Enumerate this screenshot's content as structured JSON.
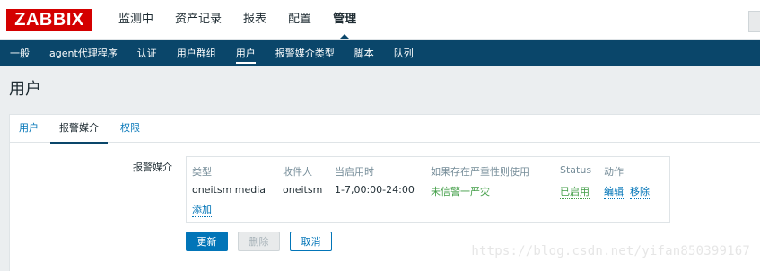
{
  "header": {
    "logo": "ZABBIX",
    "menu": [
      "监测中",
      "资产记录",
      "报表",
      "配置",
      "管理"
    ],
    "active_menu": "管理"
  },
  "submenu": {
    "items": [
      "一般",
      "agent代理程序",
      "认证",
      "用户群组",
      "用户",
      "报警媒介类型",
      "脚本",
      "队列"
    ],
    "active": "用户"
  },
  "page": {
    "title": "用户"
  },
  "tabs": {
    "items": [
      "用户",
      "报警媒介",
      "权限"
    ],
    "active": "报警媒介"
  },
  "form": {
    "media_label": "报警媒介",
    "columns": [
      "类型",
      "收件人",
      "当启用时",
      "如果存在严重性则使用",
      "Status",
      "动作"
    ],
    "row": {
      "type": "oneitsm media",
      "recipient": "oneitsm",
      "when_active": "1-7,00:00-24:00",
      "severity": "未信警一严灾",
      "status": "已启用",
      "action_edit": "编辑",
      "action_remove": "移除"
    },
    "add_link": "添加",
    "buttons": {
      "update": "更新",
      "delete": "删除",
      "cancel": "取消"
    }
  },
  "watermark": "https://blog.csdn.net/yifan850399167",
  "colors": {
    "brand_red": "#d40000",
    "nav_blue": "#0a466a",
    "link_blue": "#0275b8",
    "enabled_green": "#429e47"
  }
}
